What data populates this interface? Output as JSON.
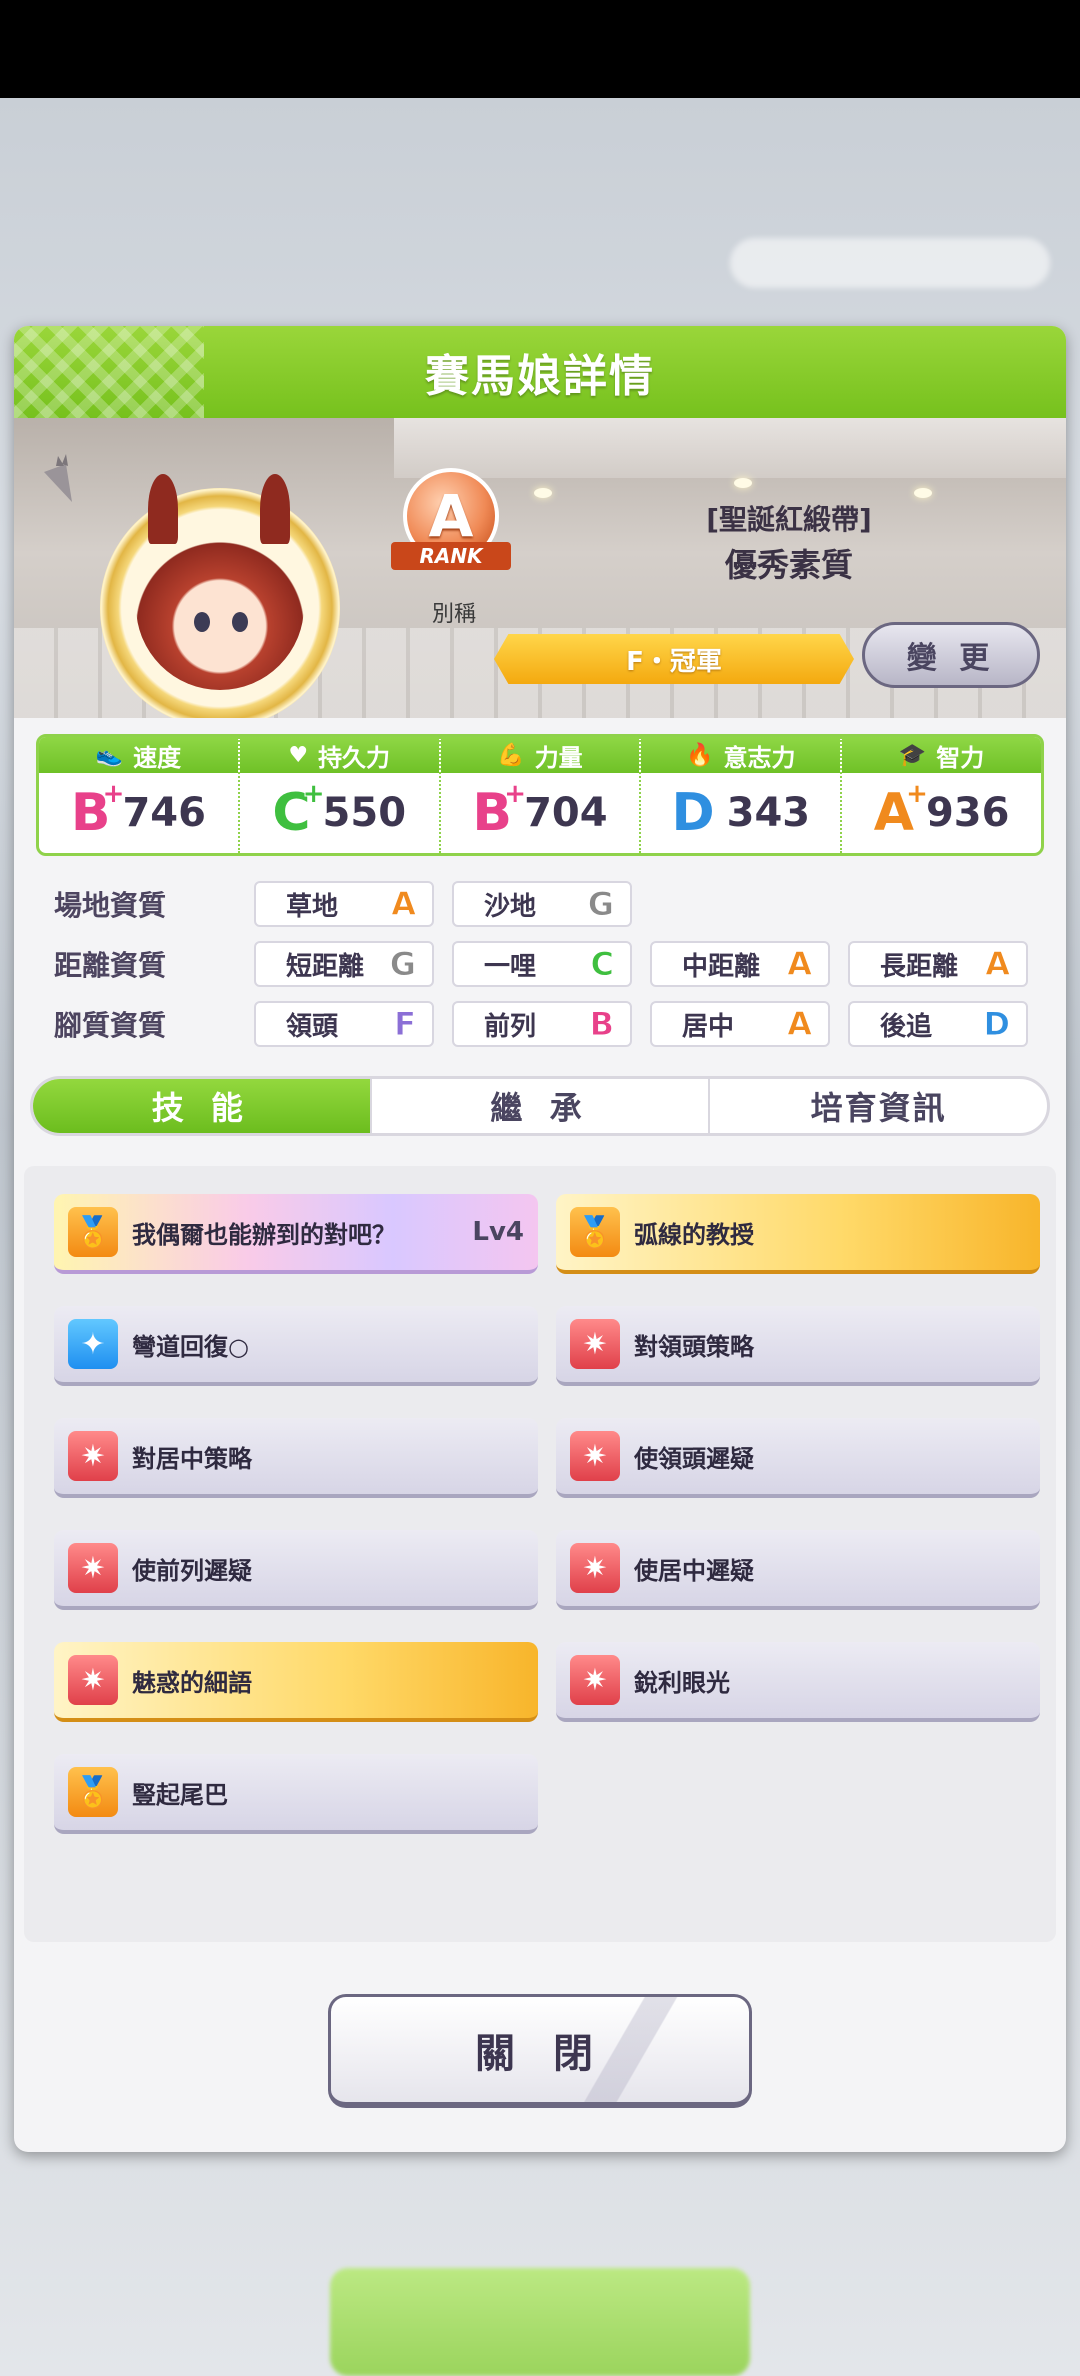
{
  "dialog": {
    "title": "賽馬娘詳情",
    "change_label": "變 更",
    "close_label": "關 閉"
  },
  "profile": {
    "rank_letter": "A",
    "rank_ribbon": "RANK",
    "rank_sub": "別稱",
    "title_bracket": "[聖誕紅緞帶]",
    "title_main": "優秀素質",
    "epithet": "F・冠軍"
  },
  "stats": [
    {
      "label": "速度",
      "icon": "shoe-icon",
      "glyph": "👟",
      "grade": "B",
      "plus": "+",
      "value": "746",
      "color": "#e8418a"
    },
    {
      "label": "持久力",
      "icon": "heart-icon",
      "glyph": "♥",
      "grade": "C",
      "plus": "+",
      "value": "550",
      "color": "#3fbf3f"
    },
    {
      "label": "力量",
      "icon": "muscle-icon",
      "glyph": "💪",
      "grade": "B",
      "plus": "+",
      "value": "704",
      "color": "#e8418a"
    },
    {
      "label": "意志力",
      "icon": "flame-icon",
      "glyph": "🔥",
      "grade": "D",
      "plus": "",
      "value": "343",
      "color": "#2f8fe0"
    },
    {
      "label": "智力",
      "icon": "graduation-cap-icon",
      "glyph": "🎓",
      "grade": "A",
      "plus": "+",
      "value": "936",
      "color": "#f08a1e"
    }
  ],
  "aptitudes": {
    "track": {
      "label": "場地資質",
      "items": [
        {
          "name": "草地",
          "grade": "A",
          "color": "#f08a1e"
        },
        {
          "name": "沙地",
          "grade": "G",
          "color": "#8a8a8a"
        }
      ]
    },
    "distance": {
      "label": "距離資質",
      "items": [
        {
          "name": "短距離",
          "grade": "G",
          "color": "#8a8a8a"
        },
        {
          "name": "一哩",
          "grade": "C",
          "color": "#3fbf3f"
        },
        {
          "name": "中距離",
          "grade": "A",
          "color": "#f08a1e"
        },
        {
          "name": "長距離",
          "grade": "A",
          "color": "#f08a1e"
        }
      ]
    },
    "style": {
      "label": "腳質資質",
      "items": [
        {
          "name": "領頭",
          "grade": "F",
          "color": "#8b6fd6"
        },
        {
          "name": "前列",
          "grade": "B",
          "color": "#e8418a"
        },
        {
          "name": "居中",
          "grade": "A",
          "color": "#f08a1e"
        },
        {
          "name": "後追",
          "grade": "D",
          "color": "#2f8fe0"
        }
      ]
    }
  },
  "tabs": [
    "技 能",
    "繼 承",
    "培育資訊"
  ],
  "skills": [
    {
      "name": "我偶爾也能辦到的對吧？",
      "level": "Lv4",
      "style": "rainbow",
      "icon": "orange"
    },
    {
      "name": "弧線的教授",
      "level": "",
      "style": "gold",
      "icon": "orange"
    },
    {
      "name": "彎道回復○",
      "level": "",
      "style": "plain",
      "icon": "blue"
    },
    {
      "name": "對領頭策略",
      "level": "",
      "style": "plain",
      "icon": "red"
    },
    {
      "name": "對居中策略",
      "level": "",
      "style": "plain",
      "icon": "red"
    },
    {
      "name": "使領頭遲疑",
      "level": "",
      "style": "plain",
      "icon": "red"
    },
    {
      "name": "使前列遲疑",
      "level": "",
      "style": "plain",
      "icon": "red"
    },
    {
      "name": "使居中遲疑",
      "level": "",
      "style": "plain",
      "icon": "red"
    },
    {
      "name": "魅惑的細語",
      "level": "",
      "style": "gold",
      "icon": "red"
    },
    {
      "name": "銳利眼光",
      "level": "",
      "style": "plain",
      "icon": "red"
    },
    {
      "name": "豎起尾巴",
      "level": "",
      "style": "plain",
      "icon": "orange"
    }
  ]
}
